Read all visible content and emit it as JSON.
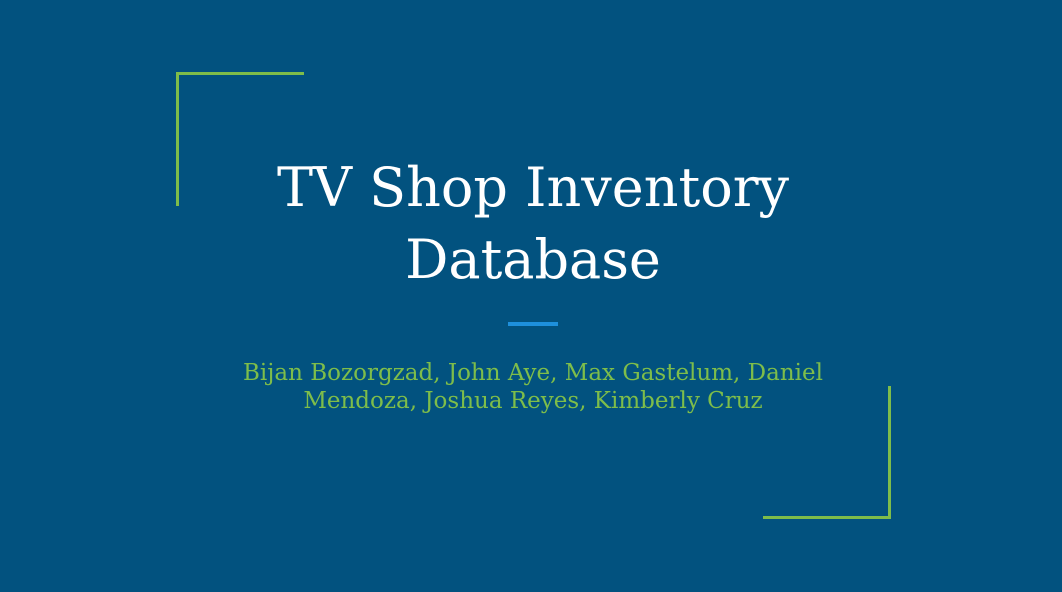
{
  "slide": {
    "title": "TV Shop Inventory\nDatabase",
    "subtitle": "Bijan Bozorgzad, John Aye, Max Gastelum, Daniel\nMendoza, Joshua Reyes, Kimberly Cruz"
  },
  "colors": {
    "background": "#02527f",
    "title": "#ffffff",
    "subtitle": "#7ebd4a",
    "accent_bracket": "#7ebd4a",
    "divider": "#1e90dc"
  }
}
